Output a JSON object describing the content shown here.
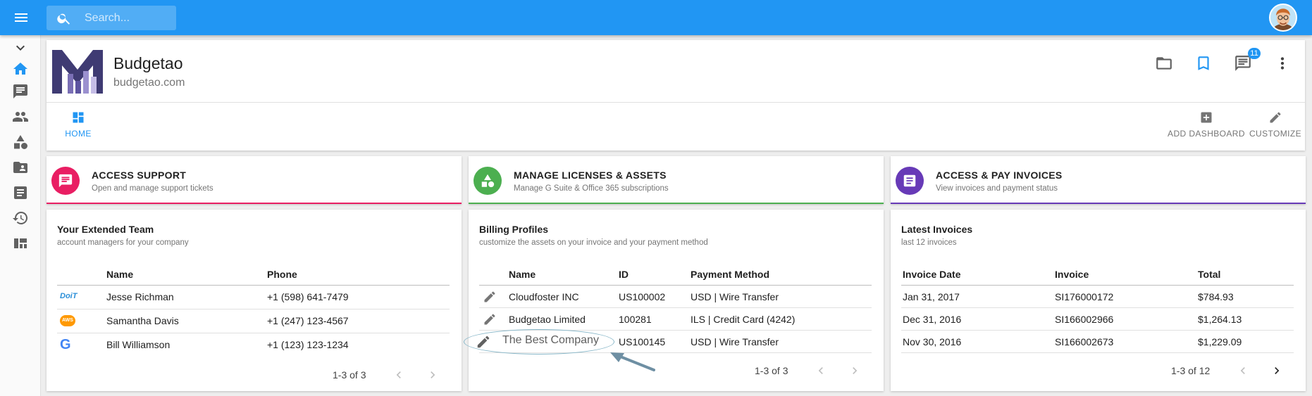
{
  "search": {
    "placeholder": "Search..."
  },
  "header": {
    "company_name": "Budgetao",
    "domain": "budgetao.com",
    "notifications_count": "11",
    "tabs": {
      "home": "HOME",
      "add_dashboard": "ADD DASHBOARD",
      "customize": "CUSTOMIZE"
    }
  },
  "sidebar": {
    "items": [
      "home-icon",
      "messages-icon",
      "people-icon",
      "assets-icon",
      "contacts-folder-icon",
      "invoices-icon",
      "history-icon",
      "dashboard-icon"
    ]
  },
  "action_cards": [
    {
      "title": "ACCESS SUPPORT",
      "subtitle": "Open and manage support tickets",
      "color": "#e91e63"
    },
    {
      "title": "MANAGE LICENSES & ASSETS",
      "subtitle": "Manage G Suite & Office 365 subscriptions",
      "color": "#4caf50"
    },
    {
      "title": "ACCESS & PAY INVOICES",
      "subtitle": "View invoices and payment status",
      "color": "#673ab7"
    }
  ],
  "team": {
    "title": "Your Extended Team",
    "subtitle": "account managers for your company",
    "columns": [
      "Name",
      "Phone"
    ],
    "rows": [
      {
        "logo": "doit-logo",
        "logo_text": "DoiT",
        "name": "Jesse Richman",
        "phone": "+1 (598) 641-7479"
      },
      {
        "logo": "aws-logo",
        "logo_text": "AWS",
        "name": "Samantha Davis",
        "phone": "+1 (247) 123-4567"
      },
      {
        "logo": "google-logo",
        "logo_text": "G",
        "name": "Bill Williamson",
        "phone": "+1 (123) 123-1234"
      }
    ],
    "pagination": "1-3 of 3"
  },
  "billing": {
    "title": "Billing Profiles",
    "subtitle": "customize the assets on your invoice and your payment method",
    "columns": [
      "Name",
      "ID",
      "Payment Method"
    ],
    "rows": [
      {
        "name": "Cloudfoster INC",
        "id": "US100002",
        "method": "USD | Wire Transfer"
      },
      {
        "name": "Budgetao Limited",
        "id": "100281",
        "method": "ILS | Credit Card (4242)"
      },
      {
        "name": "The Best Company",
        "id": "US100145",
        "method": "USD | Wire Transfer"
      }
    ],
    "pagination": "1-3 of 3"
  },
  "invoices": {
    "title": "Latest Invoices",
    "subtitle": "last 12 invoices",
    "columns": [
      "Invoice Date",
      "Invoice",
      "Total"
    ],
    "rows": [
      {
        "date": "Jan 31, 2017",
        "invoice": "SI176000172",
        "total": "$784.93"
      },
      {
        "date": "Dec 31, 2016",
        "invoice": "SI166002966",
        "total": "$1,264.13"
      },
      {
        "date": "Nov 30, 2016",
        "invoice": "SI166002673",
        "total": "$1,229.09"
      }
    ],
    "pagination": "1-3 of 12"
  },
  "colors": {
    "primary": "#2196f3",
    "support": "#e91e63",
    "licenses": "#4caf50",
    "invoices": "#673ab7"
  }
}
